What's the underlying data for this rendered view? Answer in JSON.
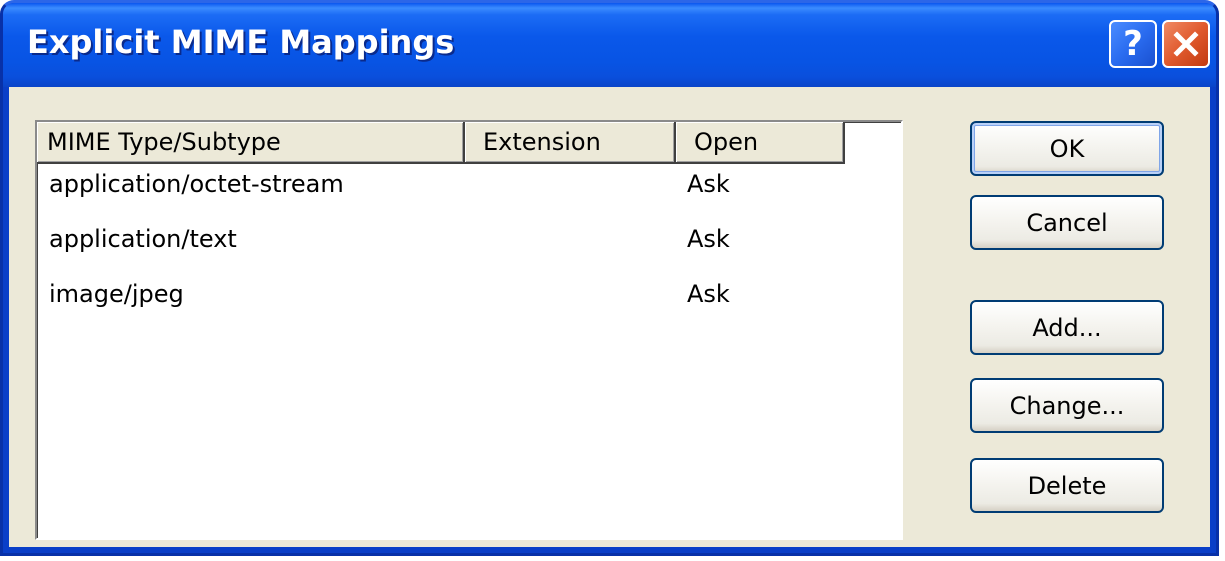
{
  "window": {
    "title": "Explicit MIME Mappings",
    "help_label": "?",
    "close_icon": "close-x-icon"
  },
  "list": {
    "columns": [
      "MIME Type/Subtype",
      "Extension",
      "Open"
    ],
    "rows": [
      {
        "type": "application/octet-stream",
        "extension": "",
        "open": "Ask"
      },
      {
        "type": "application/text",
        "extension": "",
        "open": "Ask"
      },
      {
        "type": "image/jpeg",
        "extension": "",
        "open": "Ask"
      }
    ]
  },
  "buttons": {
    "ok": "OK",
    "cancel": "Cancel",
    "add": "Add...",
    "change": "Change...",
    "delete": "Delete"
  },
  "colors": {
    "titlebar": "#0a58ea",
    "dialog_background": "#ece9d8",
    "button_border": "#003c74",
    "close_button": "#e05a2e"
  }
}
